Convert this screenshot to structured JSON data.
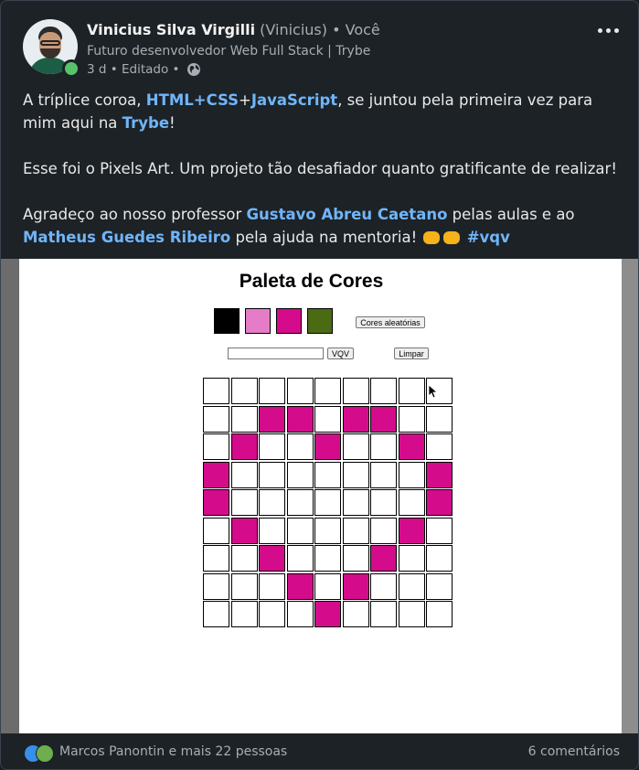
{
  "author": {
    "name": "Vinicius Silva Virgilli",
    "nickname": "(Vinicius)",
    "relation": "• Você",
    "headline": "Futuro desenvolvedor Web Full Stack | Trybe",
    "time": "3 d • Editado •",
    "online_status_color": "#57c46a",
    "visibility_icon": "globe-icon"
  },
  "menu": {
    "icon": "more-horizontal-icon"
  },
  "post": {
    "p1_a": "A tríplice coroa, ",
    "p1_html_css": "HTML+CSS",
    "p1_plus": "+",
    "p1_js": "JavaScript",
    "p1_b": ", se juntou pela primeira vez para mim aqui na ",
    "p1_trybe": "Trybe",
    "p1_c": "!",
    "p2": "Esse foi o Pixels Art. Um projeto tão desafiador quanto gratificante de realizar!",
    "p3_a": "Agradeço ao nosso professor ",
    "p3_mention1": "Gustavo Abreu Caetano",
    "p3_b": " pelas aulas e ao ",
    "p3_mention2": "Matheus Guedes Ribeiro",
    "p3_c": " pela ajuda na mentoria! ",
    "p3_hashtag": "#vqv",
    "emojis": [
      "left-facing-fist-icon",
      "right-facing-fist-icon"
    ],
    "link_color": "#70b5f9"
  },
  "screenshot": {
    "title": "Paleta de Cores",
    "palette_colors": [
      "#000000",
      "#e57cc8",
      "#d40c8c",
      "#4a6a14"
    ],
    "random_colors_button": "Cores aleatórias",
    "vqv_button": "VQV",
    "clear_button": "Limpar",
    "input_value": "",
    "paint_color": "#d40c8c",
    "board": [
      [
        0,
        0,
        0,
        0,
        0,
        0,
        0,
        0,
        0
      ],
      [
        0,
        0,
        1,
        1,
        0,
        1,
        1,
        0,
        0
      ],
      [
        0,
        1,
        0,
        0,
        1,
        0,
        0,
        1,
        0
      ],
      [
        1,
        0,
        0,
        0,
        0,
        0,
        0,
        0,
        1
      ],
      [
        1,
        0,
        0,
        0,
        0,
        0,
        0,
        0,
        1
      ],
      [
        0,
        1,
        0,
        0,
        0,
        0,
        0,
        1,
        0
      ],
      [
        0,
        0,
        1,
        0,
        0,
        0,
        1,
        0,
        0
      ],
      [
        0,
        0,
        0,
        1,
        0,
        1,
        0,
        0,
        0
      ],
      [
        0,
        0,
        0,
        0,
        1,
        0,
        0,
        0,
        0
      ]
    ]
  },
  "footer": {
    "reactions": [
      "like-icon",
      "celebrate-icon"
    ],
    "reaction_text": "Marcos Panontin e mais 22 pessoas",
    "comments": "6 comentários"
  }
}
